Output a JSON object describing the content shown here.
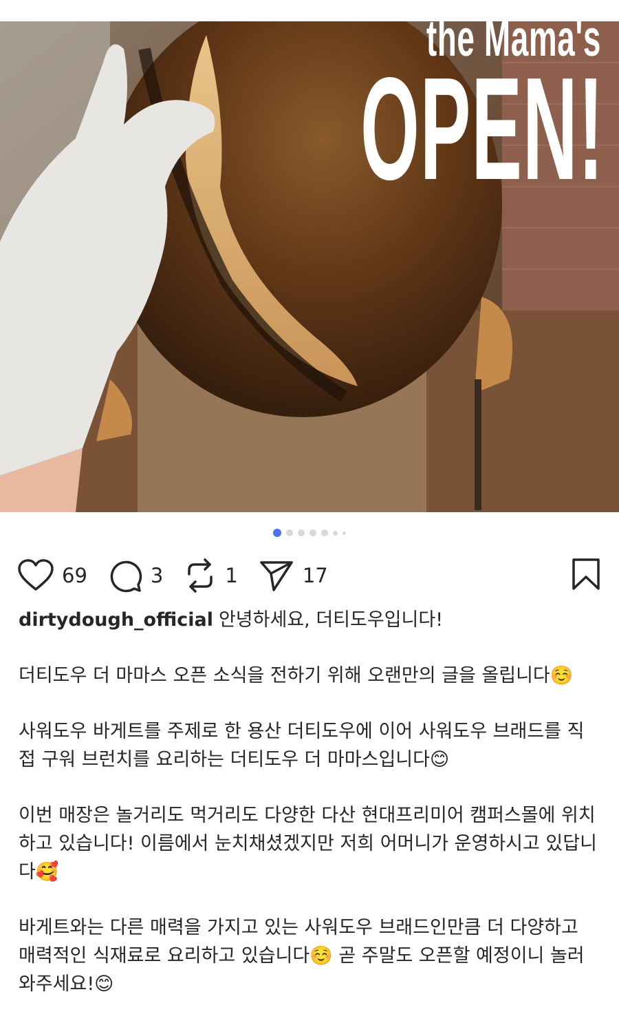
{
  "post": {
    "overlay": {
      "subtitle": "the Mama's",
      "title": "OPEN!"
    },
    "carousel": {
      "count": 7,
      "active": 1
    },
    "actions": {
      "likes": "69",
      "comments": "3",
      "reposts": "1",
      "shares": "17"
    },
    "username": "dirtydough_official",
    "caption": [
      "안녕하세요, 더티도우입니다!",
      "더티도우 더 마마스 오픈 소식을 전하기 위해 오랜만의 글을 올립니다☺️",
      "사워도우 바게트를 주제로 한 용산 더티도우에 이어 사워도우 브래드를 직접 구워 브런치를 요리하는 더티도우 더 마마스입니다😊",
      "이번 매장은 놀거리도 먹거리도 다양한 다산 현대프리미어 캠퍼스몰에 위치하고 있습니다! 이름에서 눈치채셨겠지만 저희 어머니가 운영하시고 있답니다🥰",
      "바게트와는 다른 매력을 가지고 있는 사워도우 브래드인만큼 더 다양하고 매력적인 식재료로 요리하고 있습니다☺️ 곧 주말도 오픈할 예정이니 놀러와주세요!😊"
    ],
    "icons": {
      "like": "heart-icon",
      "comment": "comment-icon",
      "repost": "repost-icon",
      "share": "share-icon",
      "save": "bookmark-icon"
    }
  }
}
